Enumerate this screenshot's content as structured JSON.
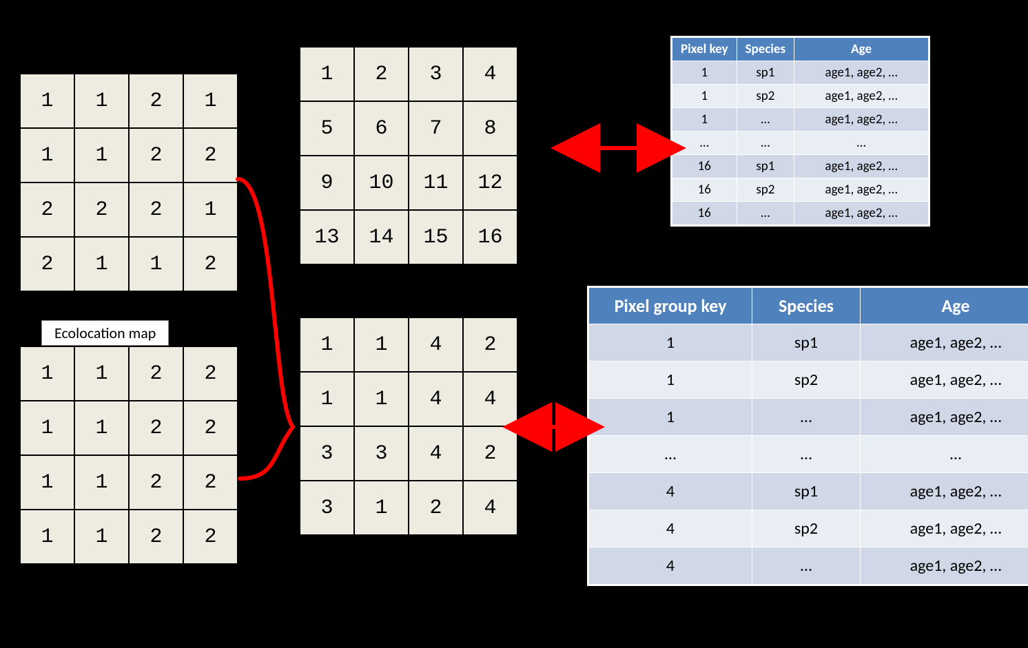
{
  "labels": {
    "ecolocation": "Ecolocation map"
  },
  "grids": {
    "topLeft": [
      [
        "1",
        "1",
        "2",
        "1"
      ],
      [
        "1",
        "1",
        "2",
        "2"
      ],
      [
        "2",
        "2",
        "2",
        "1"
      ],
      [
        "2",
        "1",
        "1",
        "2"
      ]
    ],
    "bottomLeft": [
      [
        "1",
        "1",
        "2",
        "2"
      ],
      [
        "1",
        "1",
        "2",
        "2"
      ],
      [
        "1",
        "1",
        "2",
        "2"
      ],
      [
        "1",
        "1",
        "2",
        "2"
      ]
    ],
    "topMid": [
      [
        "1",
        "2",
        "3",
        "4"
      ],
      [
        "5",
        "6",
        "7",
        "8"
      ],
      [
        "9",
        "10",
        "11",
        "12"
      ],
      [
        "13",
        "14",
        "15",
        "16"
      ]
    ],
    "bottomMid": [
      [
        "1",
        "1",
        "4",
        "2"
      ],
      [
        "1",
        "1",
        "4",
        "4"
      ],
      [
        "3",
        "3",
        "4",
        "2"
      ],
      [
        "3",
        "1",
        "2",
        "4"
      ]
    ]
  },
  "tables": {
    "top": {
      "headers": [
        "Pixel key",
        "Species",
        "Age"
      ],
      "rows": [
        [
          "1",
          "sp1",
          "age1, age2, …"
        ],
        [
          "1",
          "sp2",
          "age1, age2, …"
        ],
        [
          "1",
          "…",
          "age1, age2, …"
        ],
        [
          "…",
          "…",
          "…"
        ],
        [
          "16",
          "sp1",
          "age1, age2, …"
        ],
        [
          "16",
          "sp2",
          "age1, age2, …"
        ],
        [
          "16",
          "…",
          "age1, age2, …"
        ]
      ]
    },
    "bottom": {
      "headers": [
        "Pixel group key",
        "Species",
        "Age"
      ],
      "rows": [
        [
          "1",
          "sp1",
          "age1, age2, …"
        ],
        [
          "1",
          "sp2",
          "age1, age2, …"
        ],
        [
          "1",
          "…",
          "age1, age2, …"
        ],
        [
          "…",
          "…",
          "…"
        ],
        [
          "4",
          "sp1",
          "age1, age2, …"
        ],
        [
          "4",
          "sp2",
          "age1, age2, …"
        ],
        [
          "4",
          "…",
          "age1, age2, …"
        ]
      ]
    }
  }
}
